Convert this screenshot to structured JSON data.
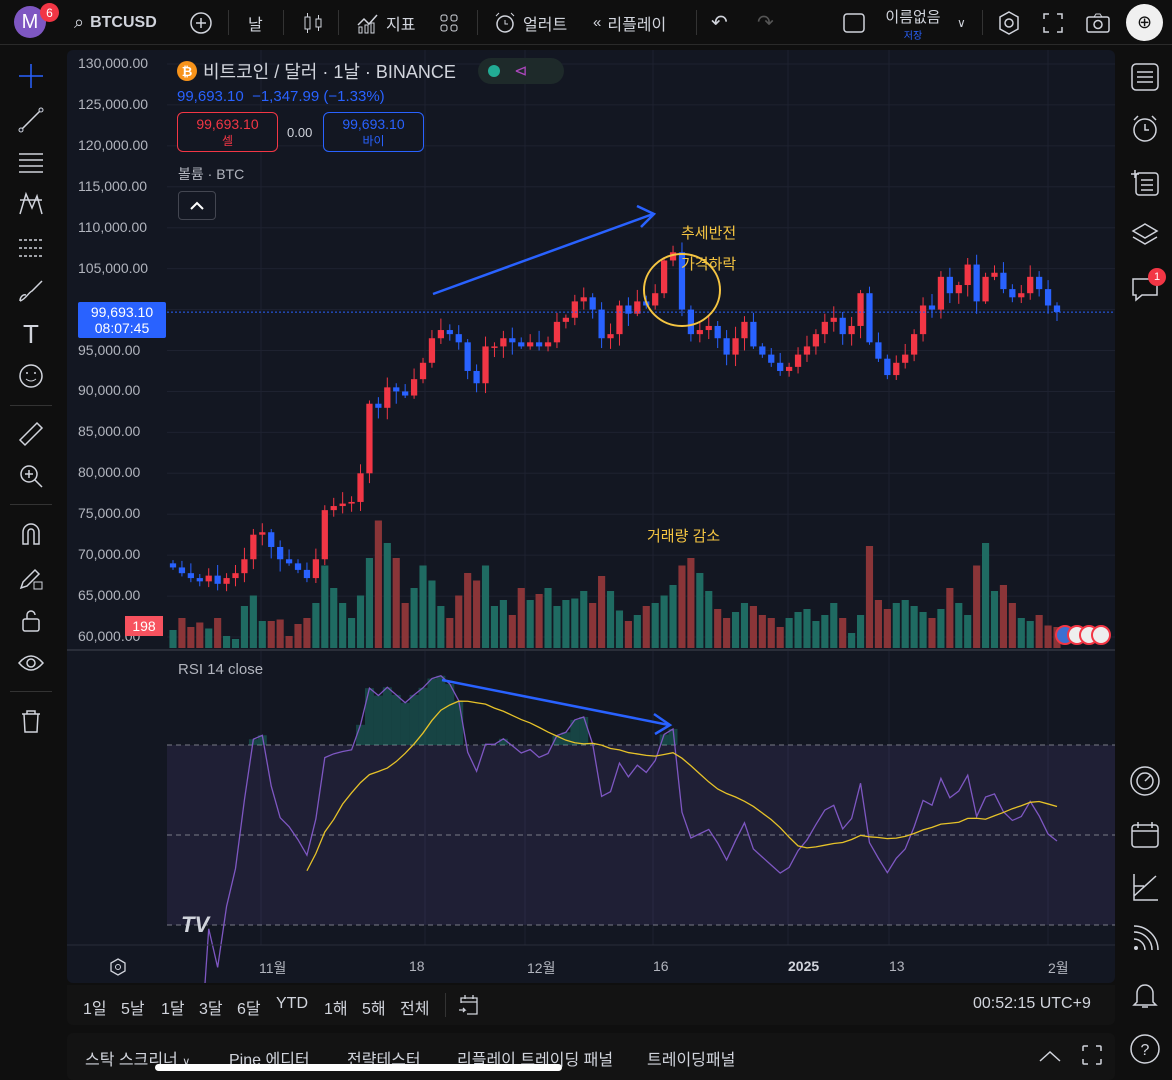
{
  "topbar": {
    "avatar_letter": "M",
    "avatar_badge": "6",
    "symbol": "BTCUSD",
    "interval": "날",
    "indicators": "지표",
    "alert": "얼러트",
    "replay": "리플레이",
    "layout_name": "이름없음",
    "layout_save": "저장"
  },
  "legend": {
    "title": "비트코인 / 달러 · 1날 · BINANCE",
    "btc_symbol": "₿",
    "last": "99,693.10",
    "change": "−1,347.99 (−1.33%)",
    "sell_price": "99,693.10",
    "sell_label": "셀",
    "spread": "0.00",
    "buy_price": "99,693.10",
    "buy_label": "바이",
    "volume_label": "볼륨 · BTC"
  },
  "price_axis": [
    "130,000.00",
    "125,000.00",
    "120,000.00",
    "115,000.00",
    "110,000.00",
    "105,000.00",
    "100,000.00",
    "95,000.00",
    "90,000.00",
    "85,000.00",
    "80,000.00",
    "75,000.00",
    "70,000.00",
    "65,000.00",
    "60,000.00"
  ],
  "current_price": {
    "price": "99,693.10",
    "countdown": "08:07:45"
  },
  "volume_last_label": "198",
  "rsi": {
    "label": "RSI 14 close",
    "levels": [
      70,
      50,
      30
    ]
  },
  "time_axis": [
    "11월",
    "18",
    "12월",
    "16",
    "2025",
    "13",
    "2월"
  ],
  "annotations": {
    "trend_reversal": "추세반전",
    "price_drop": "가격하락",
    "volume_decrease": "거래량 감소"
  },
  "ranges": [
    "1일",
    "5날",
    "1달",
    "3달",
    "6달",
    "YTD",
    "1해",
    "5해",
    "전체"
  ],
  "clock": "00:52:15 UTC+9",
  "bottom_tabs": [
    "스탁 스크리너",
    "Pine 에디터",
    "전략테스터",
    "리플레이 트레이딩 패널",
    "트레이딩패널"
  ],
  "right_badge": "1",
  "colors": {
    "up": "#f23645",
    "down": "#2962ff",
    "vol_up": "#1f6b62",
    "vol_down": "#8a3538",
    "rsi": "#7e57c2",
    "rsi_ma": "#e6c229",
    "annotation": "#f5c542"
  },
  "chart_data": {
    "type": "candlestick",
    "price_range": [
      60000,
      130000
    ],
    "closes_k": [
      68.5,
      67.8,
      67.2,
      66.8,
      67.5,
      66.5,
      67.2,
      67.8,
      69.5,
      72.5,
      72.8,
      71.0,
      69.5,
      69.0,
      68.2,
      67.2,
      69.5,
      75.5,
      76.0,
      76.3,
      76.5,
      80.0,
      88.5,
      88.0,
      90.5,
      90.0,
      89.5,
      91.5,
      93.5,
      96.5,
      97.5,
      97.0,
      96.0,
      92.5,
      91.0,
      95.5,
      95.5,
      96.5,
      96.0,
      95.5,
      96.0,
      95.5,
      96.0,
      98.5,
      99.0,
      101.0,
      101.5,
      100.0,
      96.5,
      97.0,
      100.5,
      99.5,
      101.0,
      100.5,
      102.0,
      106.0,
      107.0,
      100.0,
      97.0,
      97.5,
      98.0,
      96.5,
      94.5,
      96.5,
      98.5,
      95.5,
      94.5,
      93.5,
      92.5,
      93.0,
      94.5,
      95.5,
      97.0,
      98.5,
      99.0,
      97.0,
      98.0,
      102.0,
      96.0,
      94.0,
      92.0,
      93.5,
      94.5,
      97.0,
      100.5,
      100.0,
      104.0,
      102.0,
      103.0,
      105.5,
      101.0,
      104.0,
      104.5,
      102.5,
      101.5,
      102.0,
      104.0,
      102.5,
      100.5,
      99.7
    ],
    "volumes": [
      12,
      20,
      14,
      17,
      13,
      20,
      8,
      6,
      28,
      35,
      18,
      18,
      19,
      8,
      16,
      20,
      30,
      55,
      40,
      30,
      20,
      35,
      60,
      85,
      70,
      60,
      30,
      40,
      55,
      45,
      28,
      20,
      35,
      50,
      45,
      55,
      28,
      32,
      22,
      40,
      32,
      36,
      40,
      28,
      32,
      33,
      38,
      30,
      48,
      38,
      25,
      18,
      22,
      28,
      30,
      35,
      42,
      55,
      60,
      50,
      38,
      26,
      20,
      24,
      30,
      28,
      22,
      20,
      14,
      20,
      24,
      26,
      18,
      22,
      30,
      20,
      10,
      22,
      68,
      32,
      26,
      30,
      32,
      28,
      24,
      20,
      26,
      40,
      30,
      22,
      55,
      70,
      38,
      42,
      30,
      20,
      18,
      22,
      15,
      14
    ],
    "rsi_period": 14,
    "rsi_ma_period": 14
  }
}
